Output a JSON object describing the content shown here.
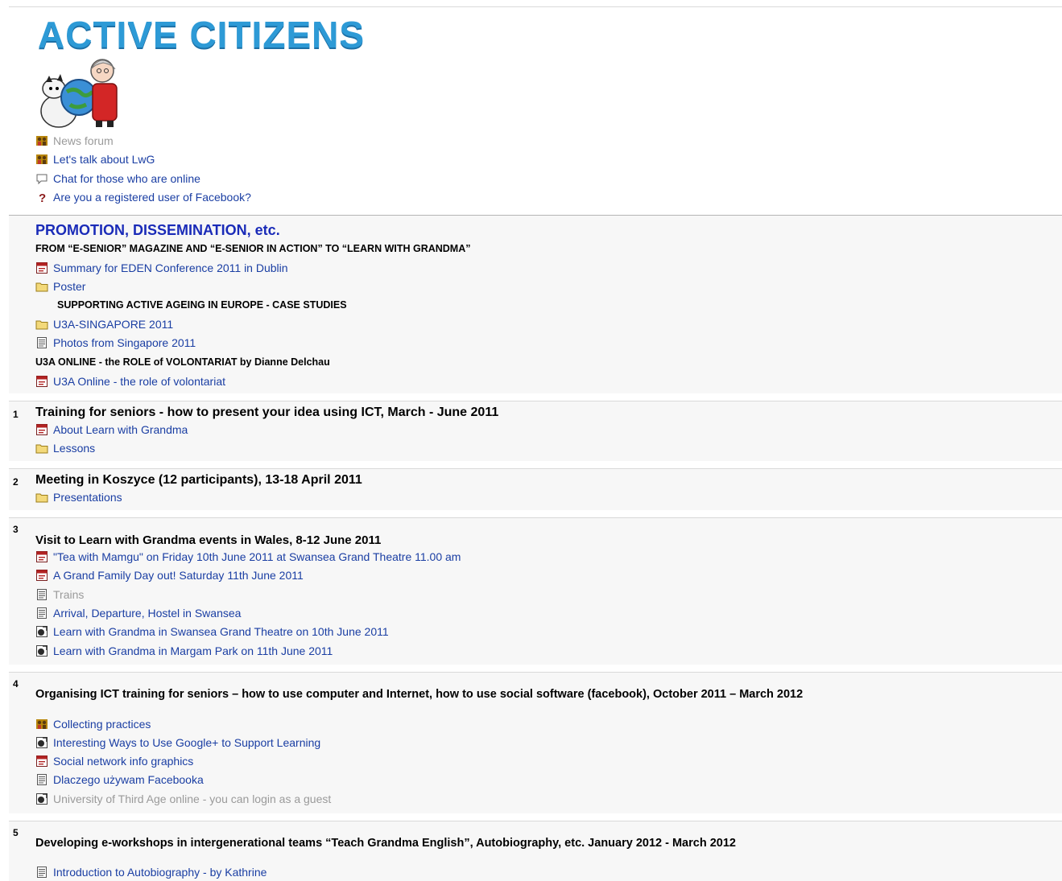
{
  "banner": {
    "title": "ACTIVE CITIZENS"
  },
  "intro": {
    "items": [
      {
        "label": "News forum",
        "icon": "forum-icon",
        "dim": true
      },
      {
        "label": "Let's talk about LwG",
        "icon": "forum-icon"
      },
      {
        "label": "Chat for those who are online",
        "icon": "chat-icon"
      },
      {
        "label": "Are you a registered user of Facebook?",
        "icon": "question-icon"
      }
    ]
  },
  "promotion": {
    "heading": "PROMOTION, DISSEMINATION, etc.",
    "label1": "FROM “E-SENIOR” MAGAZINE AND “E-SENIOR IN ACTION” TO “LEARN WITH GRANDMA”",
    "summary": "Summary for EDEN Conference 2011 in Dublin",
    "poster": "Poster",
    "label2": "SUPPORTING ACTIVE AGEING IN EUROPE - CASE STUDIES",
    "u3a_singapore": "U3A-SINGAPORE 2011",
    "photos": "Photos from Singapore 2011",
    "label3": "U3A ONLINE - the ROLE of VOLONTARIAT by Dianne Delchau",
    "u3a_online": "U3A Online - the role of volontariat"
  },
  "topic1": {
    "number": "1",
    "title": "Training for seniors - how to present your idea using ICT, March - June 2011",
    "items": [
      "About Learn with Grandma",
      "Lessons"
    ]
  },
  "topic2": {
    "number": "2",
    "title": "Meeting in Koszyce (12 participants), 13-18 April 2011",
    "items": [
      "Presentations"
    ]
  },
  "topic3": {
    "number": "3",
    "title": "Visit to Learn with Grandma events in Wales, 8-12 June 2011",
    "items": [
      "\"Tea with Mamgu\" on Friday 10th June 2011 at Swansea Grand Theatre 11.00 am",
      "A Grand Family Day out! Saturday 11th June 2011",
      "Trains",
      "Arrival, Departure, Hostel in Swansea",
      "Learn with Grandma in Swansea Grand Theatre on 10th June 2011",
      "Learn with Grandma in Margam Park on 11th June 2011"
    ]
  },
  "topic4": {
    "number": "4",
    "title": "Organising ICT training for seniors – how to use computer and Internet, how to use social software (facebook), October 2011 – March 2012",
    "items": [
      "Collecting practices",
      "Interesting Ways to Use Google+ to Support Learning",
      "Social network info graphics",
      "Dlaczego używam Facebooka",
      "University of Third Age online - you can login as a guest"
    ]
  },
  "topic5": {
    "number": "5",
    "title": "Developing e-workshops in intergenerational teams “Teach Grandma English”, Autobiography, etc. January 2012 - March 2012",
    "items": [
      "Introduction to Autobiography - by Kathrine"
    ]
  },
  "colors": {
    "link": "#1a3ea3",
    "dimLink": "#9a9a9a",
    "heading": "#1a2bb8",
    "banner": "#2d9ad6"
  }
}
